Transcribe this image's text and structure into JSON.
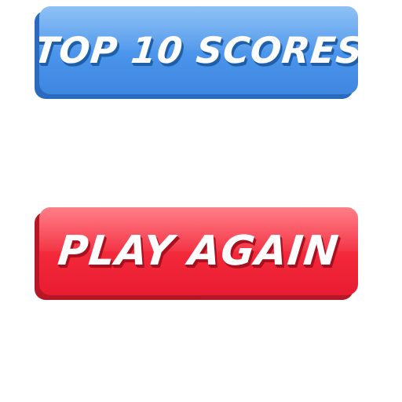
{
  "buttons": {
    "top_scores": {
      "label": "TOP 10 SCORES",
      "color": "#4a94eb",
      "shadow_color": "#2b6bbf"
    },
    "play_again": {
      "label": "PLAY AGAIN",
      "color": "#f2283a",
      "shadow_color": "#b51726"
    }
  },
  "colors": {
    "background": "#ffffff",
    "label_text": "#ffffff"
  }
}
